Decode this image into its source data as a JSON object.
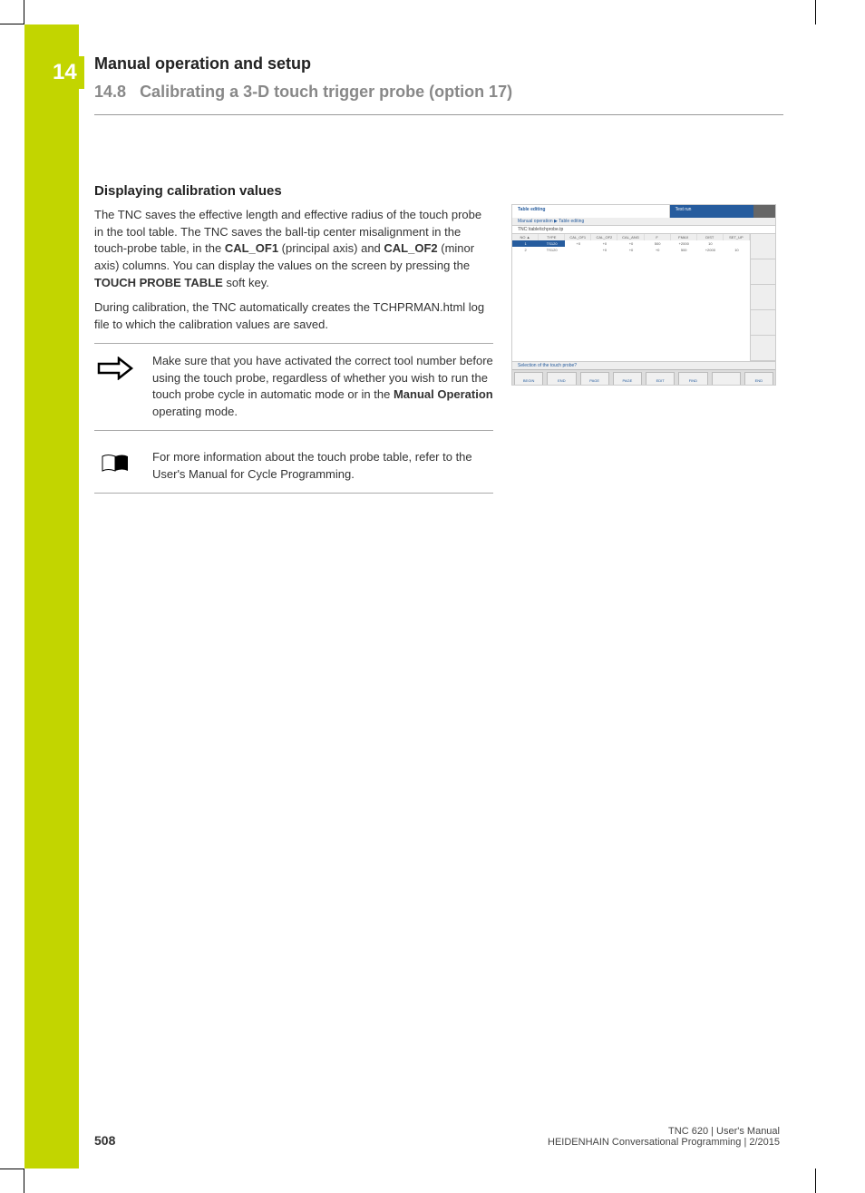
{
  "chapter": {
    "num": "14",
    "title": "Manual operation and setup"
  },
  "section": {
    "num": "14.8",
    "title": "Calibrating a 3-D touch trigger probe (option 17)"
  },
  "subhead": "Displaying calibration values",
  "p1a": "The TNC saves the effective length and effective radius of the touch probe in the tool table. The TNC saves the ball-tip center misalignment in the touch-probe table, in the ",
  "p1b": "CAL_OF1",
  "p1c": " (principal axis) and ",
  "p1d": "CAL_OF2",
  "p1e": " (minor axis) columns. You can display the values on the screen by pressing the ",
  "p1f": "TOUCH PROBE TABLE",
  "p1g": " soft key.",
  "p2": "During calibration, the TNC automatically creates the TCHPRMAN.html log file to which the calibration values are saved.",
  "note1a": "Make sure that you have activated the correct tool number before using the touch probe, regardless of whether you wish to run the touch probe cycle in automatic mode or in the ",
  "note1b": "Manual Operation",
  "note1c": " operating mode.",
  "note2": "For more information about the touch probe table, refer to the User's Manual for Cycle Programming.",
  "shot": {
    "tab1": "Table editing",
    "tab2": "Test run",
    "sub": "Manual operation ▶ Table editing",
    "path": "TNC:\\table\\tchprobe.tp",
    "cols": [
      "NO ▲",
      "TYPE",
      "CAL_OF1",
      "CAL_OF2",
      "CAL_ANG",
      "F",
      "FMAX",
      "DIST",
      "SET_UP"
    ],
    "r1": [
      "1",
      "TS120",
      "+0",
      "+0",
      "+0",
      "500",
      "+2000",
      "10",
      ""
    ],
    "r2": [
      "2",
      "TS120",
      "",
      "+0",
      "+0",
      "+0",
      "500",
      "+2000",
      "10"
    ],
    "status": "Selection of the touch probe?",
    "sk": [
      "BEGIN",
      "END",
      "PAGE",
      "PAGE",
      "EDIT",
      "FIND",
      "",
      "END"
    ]
  },
  "footer1": "TNC 620 | User's Manual",
  "footer2": "HEIDENHAIN Conversational Programming | 2/2015",
  "pagenum": "508"
}
